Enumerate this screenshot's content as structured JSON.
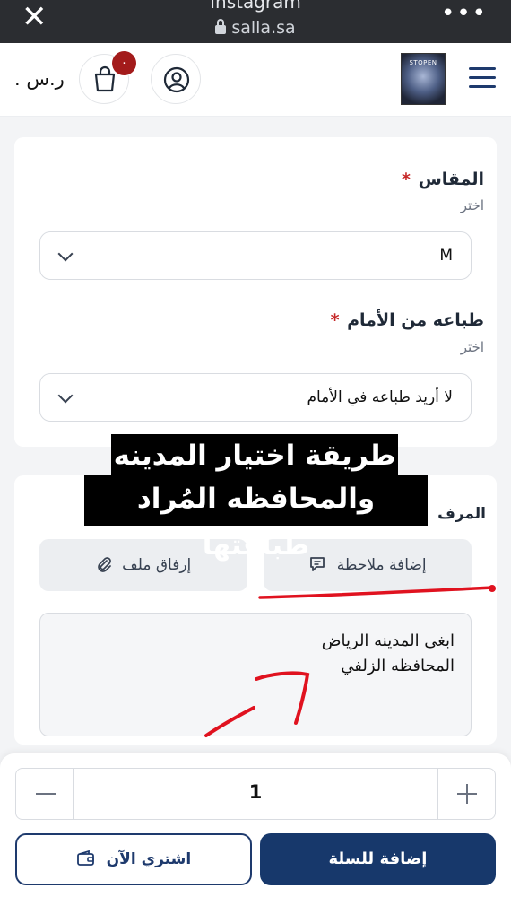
{
  "browser": {
    "site_title": "Instagram",
    "url": "salla.sa",
    "close_icon": "close-icon",
    "more_icon": "more-dots-icon"
  },
  "header": {
    "currency": ". ر.س",
    "cart_badge": ".",
    "icons": [
      "cart-icon",
      "user-icon",
      "menu-icon"
    ],
    "logo_text": "STOPEN"
  },
  "form": {
    "size": {
      "label": "المقاس",
      "required_mark": "*",
      "hint": "اختر",
      "value": "M"
    },
    "front_print": {
      "label": "طباعه من الأمام",
      "required_mark": "*",
      "hint": "اختر",
      "value": "لا أريد طباعه في الأمام"
    },
    "attachments": {
      "label_peek": "المرف",
      "add_note": "إضافة ملاحظة",
      "attach_file": "إرفاق ملف",
      "note_lines": [
        "ابغى المدينه الرياض",
        "المحافظه الزلفي"
      ]
    }
  },
  "overlay": {
    "line1": "طريقة اختيار المدينه",
    "line2": "والمحافظه المُراد طباعتها"
  },
  "purchase": {
    "quantity": "1",
    "buy_now": "اشتري الآن",
    "add_to_cart": "إضافة للسلة"
  },
  "colors": {
    "primary": "#17386b",
    "badge": "#a31b1b",
    "annotation": "#e0121f"
  }
}
